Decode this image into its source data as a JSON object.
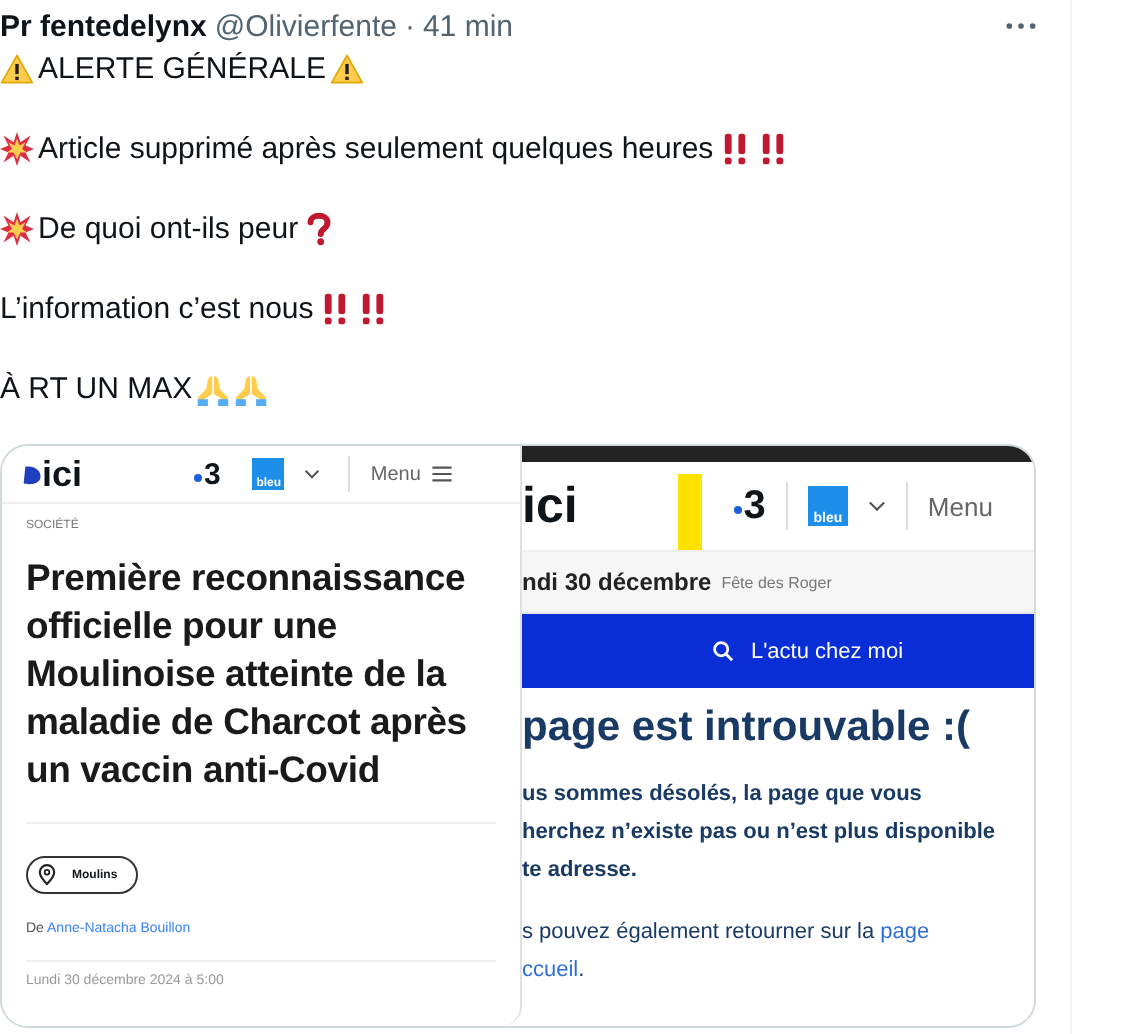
{
  "tweet": {
    "author": "Pr fentedelynx",
    "handle": "@Olivierfente",
    "separator": "·",
    "time": "41 min",
    "lines": [
      {
        "prefix": [
          {
            "kind": "warning"
          }
        ],
        "text": "ALERTE GÉNÉRALE",
        "suffix": [
          {
            "kind": "warning"
          }
        ]
      },
      {
        "prefix": [
          {
            "kind": "explosion"
          }
        ],
        "text": "Article supprimé après seulement quelques heures",
        "suffix": [
          {
            "kind": "exclamation"
          },
          {
            "kind": "exclamation"
          }
        ]
      },
      {
        "prefix": [
          {
            "kind": "explosion"
          }
        ],
        "text": "De quoi ont-ils peur",
        "suffix": [
          {
            "kind": "question"
          }
        ]
      },
      {
        "text": "L’information c’est nous",
        "suffix": [
          {
            "kind": "exclamation"
          },
          {
            "kind": "exclamation"
          }
        ]
      },
      {
        "text": "À RT UN MAX",
        "suffix": [
          {
            "kind": "prayer"
          },
          {
            "kind": "prayer"
          }
        ]
      }
    ]
  },
  "article": {
    "brand": "ici",
    "channel": "3",
    "partner": "bleu",
    "menu": "Menu",
    "section": "SOCIÉTÉ",
    "headline": "Première reconnaissance officielle pour une Moulinoise atteinte de la maladie de Charcot après un vaccin anti-Covid",
    "location": "Moulins",
    "byline_prefix": "De",
    "byline_author": "Anne-Natacha Bouillon",
    "date": "Lundi 30 décembre 2024 à 5:00"
  },
  "error_page": {
    "brand": "ici",
    "channel": "3",
    "partner": "bleu",
    "menu": "Menu",
    "date": "ndi 30 décembre",
    "saint": "Fête des Roger",
    "search_button": "L'actu chez moi",
    "heading": "page est introuvable :(",
    "message_lines": [
      "us sommes désolés, la page que vous",
      "herchez n’existe pas ou n’est plus disponible",
      "te adresse."
    ],
    "link_lines": [
      {
        "text": "s pouvez également retourner sur la",
        "link": "page"
      },
      {
        "link": "ccueil",
        "after": "."
      }
    ]
  }
}
